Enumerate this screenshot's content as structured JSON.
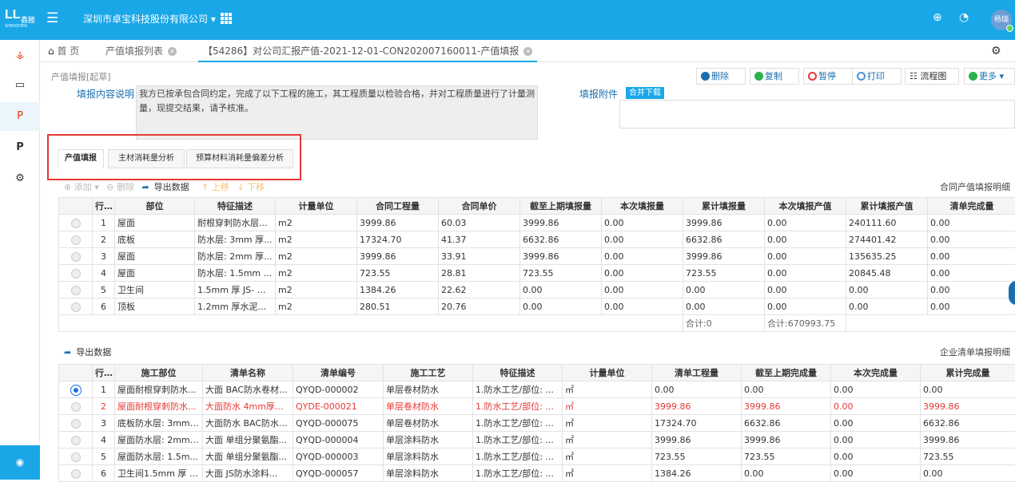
{
  "topbar": {
    "logo_mark": "LL",
    "logo_text": "鑫塍",
    "logo_sub": "SHENZHEN",
    "company": "深圳市卓宝科技股份有限公司 ▾",
    "user": "杨瑞"
  },
  "sidebar": {
    "items": [
      "sitemap-icon",
      "monitor-icon",
      "paypal-icon",
      "paypal-icon",
      "gears-icon"
    ]
  },
  "tabs": [
    {
      "label": "首 页"
    },
    {
      "label": "产值填报列表"
    },
    {
      "label": "【54286】对公司汇报产值-2021-12-01-CON202007160011-产值填报"
    }
  ],
  "toolbar": {
    "crumb": "产值填报[起草]",
    "buttons": [
      "删除",
      "复制",
      "暂停",
      "打印",
      "流程图",
      "更多 ▾"
    ],
    "button_colors": [
      "#1a6fb0",
      "#2bb24c",
      "#e53935",
      "#4a90d9",
      "#333",
      "#2bb24c"
    ]
  },
  "form": {
    "desc_label": "填报内容说明",
    "desc_text": "我方已按承包合同约定，完成了以下工程的施工，其工程质量以检验合格，并对工程质量进行了计量测量，现提交结果，请予核准。",
    "attach_label": "填报附件",
    "attach_btn": "合并下载"
  },
  "subtabs": [
    "产值填报",
    "主材消耗量分析",
    "预算材料消耗量偏差分析"
  ],
  "table1": {
    "tools": [
      "⊕ 添加 ▾",
      "⊖ 删除",
      "导出数据",
      "↑ 上移",
      "↓ 下移"
    ],
    "title": "合同产值填报明细",
    "headers": [
      "",
      "行号",
      "部位",
      "特征描述",
      "计量单位",
      "合同工程量",
      "合同单价",
      "截至上期填报量",
      "本次填报量",
      "累计填报量",
      "本次填报产值",
      "累计填报产值",
      "清单完成量"
    ],
    "rows": [
      [
        "1",
        "屋面",
        "耐根穿刺防水层...",
        "m2",
        "3999.86",
        "60.03",
        "3999.86",
        "0.00",
        "3999.86",
        "0.00",
        "240111.60",
        "0.00"
      ],
      [
        "2",
        "底板",
        "防水层: 3mm 厚...",
        "m2",
        "17324.70",
        "41.37",
        "6632.86",
        "0.00",
        "6632.86",
        "0.00",
        "274401.42",
        "0.00"
      ],
      [
        "3",
        "屋面",
        "防水层: 2mm 厚...",
        "m2",
        "3999.86",
        "33.91",
        "3999.86",
        "0.00",
        "3999.86",
        "0.00",
        "135635.25",
        "0.00"
      ],
      [
        "4",
        "屋面",
        "防水层: 1.5mm ...",
        "m2",
        "723.55",
        "28.81",
        "723.55",
        "0.00",
        "723.55",
        "0.00",
        "20845.48",
        "0.00"
      ],
      [
        "5",
        "卫生间",
        "1.5mm 厚 JS- 工...",
        "m2",
        "1384.26",
        "22.62",
        "0.00",
        "0.00",
        "0.00",
        "0.00",
        "0.00",
        "0.00"
      ],
      [
        "6",
        "顶板",
        "1.2mm 厚水泥基...",
        "m2",
        "280.51",
        "20.76",
        "0.00",
        "0.00",
        "0.00",
        "0.00",
        "0.00",
        "0.00"
      ]
    ],
    "sum1": "合计:0",
    "sum2": "合计:670993.75"
  },
  "table2": {
    "tools": [
      "导出数据"
    ],
    "title": "企业清单填报明细",
    "headers": [
      "",
      "行号",
      "施工部位",
      "清单名称",
      "清单编号",
      "施工工艺",
      "特征描述",
      "计量单位",
      "清单工程量",
      "截至上期完成量",
      "本次完成量",
      "累计完成量"
    ],
    "rows": [
      [
        "1",
        "屋面耐根穿刺防水...",
        "大面 BAC防水卷材...",
        "QYQD-000002",
        "单层卷材防水",
        "1.防水工艺/部位: ...",
        "㎡",
        "0.00",
        "0.00",
        "0.00",
        "0.00"
      ],
      [
        "2",
        "屋面耐根穿刺防水...",
        "大面防水 4mm厚...",
        "QYDE-000021",
        "单层卷材防水",
        "1.防水工艺/部位: ...",
        "㎡",
        "3999.86",
        "3999.86",
        "0.00",
        "3999.86"
      ],
      [
        "3",
        "底板防水层: 3mm ...",
        "大面防水 BAC防水...",
        "QYQD-000075",
        "单层卷材防水",
        "1.防水工艺/部位: ...",
        "㎡",
        "17324.70",
        "6632.86",
        "0.00",
        "6632.86"
      ],
      [
        "4",
        "屋面防水层: 2mm ...",
        "大面 单组分聚氨酯...",
        "QYQD-000004",
        "单层涂料防水",
        "1.防水工艺/部位: ...",
        "㎡",
        "3999.86",
        "3999.86",
        "0.00",
        "3999.86"
      ],
      [
        "5",
        "屋面防水层: 1.5m...",
        "大面 单组分聚氨酯...",
        "QYQD-000003",
        "单层涂料防水",
        "1.防水工艺/部位: ...",
        "㎡",
        "723.55",
        "723.55",
        "0.00",
        "723.55"
      ],
      [
        "6",
        "卫生间1.5mm 厚 J...",
        "大面 JS防水涂料...",
        "QYQD-000057",
        "单层涂料防水",
        "1.防水工艺/部位: ...",
        "㎡",
        "1384.26",
        "0.00",
        "0.00",
        "0.00"
      ]
    ]
  }
}
